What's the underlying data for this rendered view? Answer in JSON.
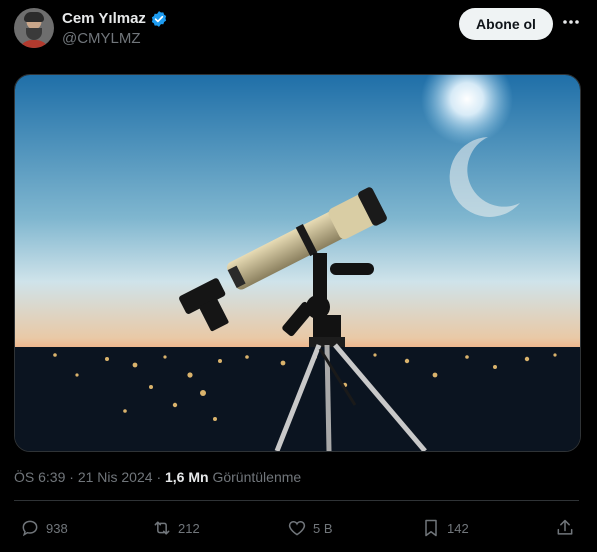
{
  "author": {
    "name": "Cem Yılmaz",
    "handle": "@CMYLMZ",
    "verified": true
  },
  "follow_label": "Abone ol",
  "media": {
    "subject": "telescope-at-dusk-photo",
    "colors": {
      "sky_top": "#1f6fa8",
      "sky_mid": "#cfe3ea",
      "horizon": "#ff7a3d",
      "ground": "#0b1420"
    }
  },
  "meta": {
    "time": "ÖS 6:39",
    "date": "21 Nis 2024",
    "views_count": "1,6 Mn",
    "views_label": "Görüntülenme"
  },
  "actions": {
    "replies": "938",
    "reposts": "212",
    "likes": "5 B",
    "bookmarks": "142"
  },
  "icons": [
    "verified-badge-icon",
    "more-icon",
    "reply-icon",
    "repost-icon",
    "like-icon",
    "bookmark-icon",
    "share-icon"
  ],
  "theme": {
    "background": "#000000",
    "text": "#e7e9ea",
    "muted": "#71767b",
    "accent": "#1d9bf0",
    "border": "#2f3336"
  }
}
